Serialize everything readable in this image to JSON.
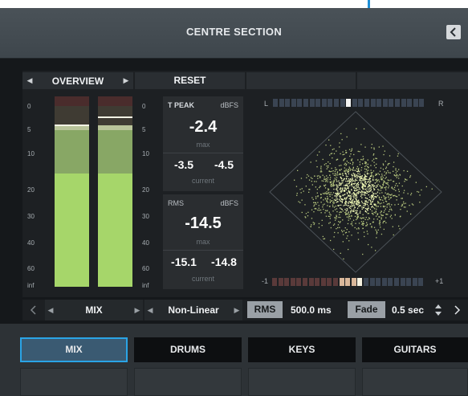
{
  "window": {
    "title": "CENTRE SECTION"
  },
  "colors": {
    "accent": "#2aa4e6",
    "meter_green": "#a6d66a",
    "scatter": "#e8f2a0"
  },
  "toolbar": {
    "view_prev_icon": "left-triangle-icon",
    "view_label": "OVERVIEW",
    "view_next_icon": "right-triangle-icon",
    "reset_label": "RESET"
  },
  "meters": {
    "scale_left": [
      "0",
      "5",
      "10",
      "20",
      "30",
      "40",
      "60",
      "inf"
    ],
    "scale_right": [
      "0",
      "5",
      "10",
      "20",
      "30",
      "40",
      "60",
      "inf"
    ]
  },
  "true_peak": {
    "label": "T PEAK",
    "unit": "dBFS",
    "max_value": "-2.4",
    "max_label": "max",
    "current_left": "-3.5",
    "current_right": "-4.5",
    "current_label": "current"
  },
  "rms": {
    "label": "RMS",
    "unit": "dBFS",
    "max_value": "-14.5",
    "max_label": "max",
    "current_left": "-15.1",
    "current_right": "-14.8",
    "current_label": "current"
  },
  "goniometer": {
    "left_label": "L",
    "right_label": "R",
    "corr_min_label": "-1",
    "corr_max_label": "+1",
    "balance_position": 0.5,
    "correlation_position": 0.6
  },
  "controls": {
    "source_label": "MIX",
    "scale_mode_label": "Non-Linear",
    "rms_chip": "RMS",
    "rms_time": "500.0 ms",
    "fade_chip": "Fade",
    "fade_time": "0.5 sec"
  },
  "tabs": [
    "MIX",
    "DRUMS",
    "KEYS",
    "GUITARS"
  ]
}
